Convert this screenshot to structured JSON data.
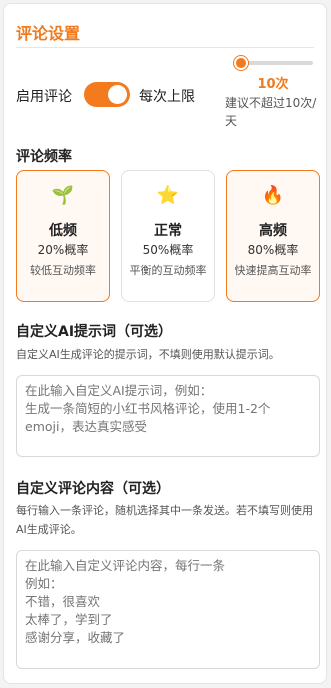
{
  "header": {
    "title": "评论设置"
  },
  "enable": {
    "label": "启用评论",
    "on": true,
    "limit_label": "每次上限"
  },
  "limit": {
    "value": "10次",
    "hint": "建议不超过10次/天",
    "fraction": 0.1
  },
  "frequency": {
    "heading": "评论频率",
    "options": [
      {
        "icon": "seedling-icon",
        "glyph": "🌱",
        "name": "低频",
        "prob": "20%概率",
        "desc": "较低互动频率",
        "selected": true
      },
      {
        "icon": "star-icon",
        "glyph": "⭐",
        "name": "正常",
        "prob": "50%概率",
        "desc": "平衡的互动频率",
        "selected": false
      },
      {
        "icon": "fire-icon",
        "glyph": "🔥",
        "name": "高频",
        "prob": "80%概率",
        "desc": "快速提高互动率",
        "selected": true
      }
    ]
  },
  "ai_prompt": {
    "heading": "自定义AI提示词（可选）",
    "desc": "自定义AI生成评论的提示词，不填则使用默认提示词。",
    "placeholder": "在此输入自定义AI提示词，例如：\n生成一条简短的小红书风格评论，使用1-2个emoji，表达真实感受"
  },
  "custom_comments": {
    "heading": "自定义评论内容（可选）",
    "desc": "每行输入一条评论，随机选择其中一条发送。若不填写则使用AI生成评论。",
    "placeholder": "在此输入自定义评论内容，每行一条\n例如：\n不错，很喜欢\n太棒了，学到了\n感谢分享，收藏了"
  },
  "colors": {
    "accent": "#f37b1d"
  }
}
